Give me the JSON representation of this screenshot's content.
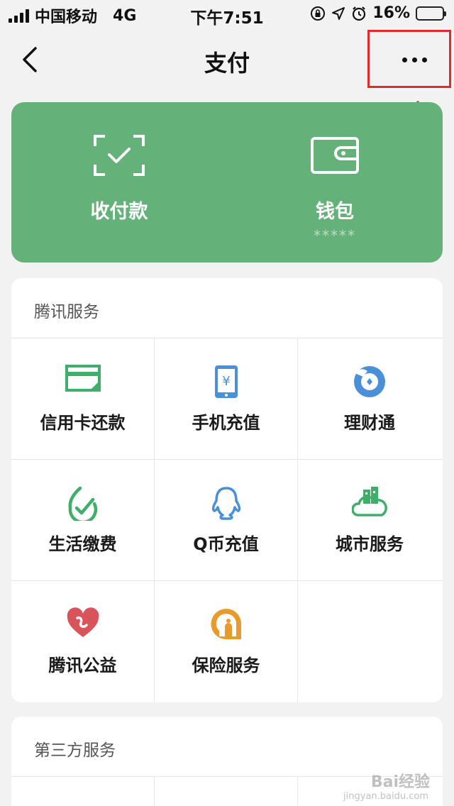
{
  "status_bar": {
    "carrier": "中国移动",
    "network": "4G",
    "time": "下午7:51",
    "battery": "16%",
    "battery_level": 0.16
  },
  "nav": {
    "title": "支付",
    "back_icon": "chevron-left-icon",
    "more_icon": "more-dots-icon"
  },
  "pay_card": {
    "color": "#64b27a",
    "receive": {
      "label": "收付款",
      "icon": "scan-check-icon"
    },
    "wallet": {
      "label": "钱包",
      "sub": "*****",
      "icon": "wallet-icon"
    }
  },
  "tencent_services": {
    "title": "腾讯服务",
    "items": [
      {
        "label": "信用卡还款",
        "icon": "credit-card-icon"
      },
      {
        "label": "手机充值",
        "icon": "phone-yuan-icon"
      },
      {
        "label": "理财通",
        "icon": "wealth-icon"
      },
      {
        "label": "生活缴费",
        "icon": "utility-check-icon"
      },
      {
        "label": "Q币充值",
        "icon": "qq-penguin-icon"
      },
      {
        "label": "城市服务",
        "icon": "city-cloud-icon"
      },
      {
        "label": "腾讯公益",
        "icon": "charity-heart-icon"
      },
      {
        "label": "保险服务",
        "icon": "insurance-icon"
      }
    ]
  },
  "third_party_services": {
    "title": "第三方服务"
  },
  "watermark": {
    "text": "Bai经验",
    "sub": "jingyan.baidu.com"
  },
  "colors": {
    "highlight": "#e12a2a",
    "green": "#64b27a",
    "blue": "#4a90d9",
    "orange": "#e89a2c",
    "red": "#d9545a"
  }
}
